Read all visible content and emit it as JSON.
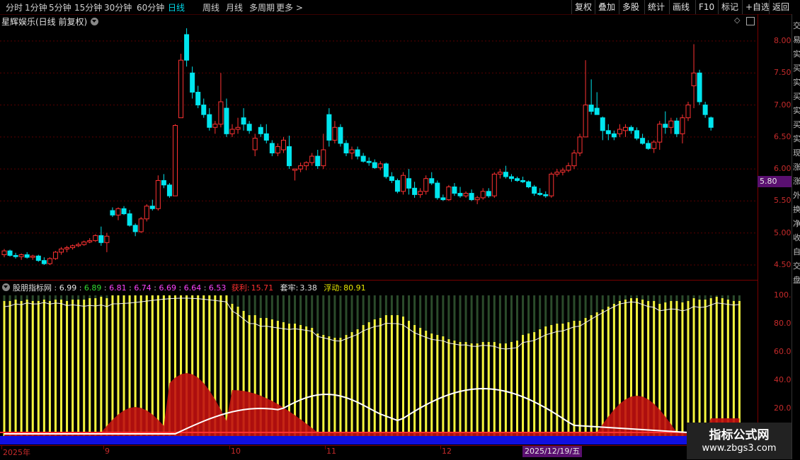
{
  "toolbar": {
    "periods": [
      "分时",
      "1分钟",
      "5分钟",
      "15分钟",
      "30分钟",
      "60分钟",
      "日线",
      "周线",
      "月线",
      "多周期",
      "更多 >"
    ],
    "active": "日线",
    "right_buttons": [
      "复权",
      "叠加",
      "多股",
      "统计",
      "画线",
      "F10",
      "标记",
      "+自选",
      "返回"
    ]
  },
  "chart": {
    "title": "星辉娱乐(日线 前复权)",
    "price_axis": [
      "8.00",
      "7.50",
      "7.00",
      "6.50",
      "6.00",
      "5.50",
      "5.00",
      "4.50"
    ],
    "current_price": "5.80",
    "colors": {
      "up": "#ff3232",
      "down": "#00e5ee",
      "grid": "#7a0000",
      "axis_text": "#c62b2b"
    }
  },
  "indicator": {
    "name": "股朋指标网",
    "values": [
      {
        "text": "6.99",
        "color": "#e8e8e8"
      },
      {
        "text": "6.89",
        "color": "#33dd33"
      },
      {
        "text": "6.81",
        "color": "#ff44ff"
      },
      {
        "text": "6.74",
        "color": "#ff44ff"
      },
      {
        "text": "6.69",
        "color": "#ff44ff"
      },
      {
        "text": "6.64",
        "color": "#ff44ff"
      },
      {
        "text": "6.53",
        "color": "#ff44ff"
      }
    ],
    "profit_label": "获利:",
    "profit_value": "15.71",
    "trapped_label": "套牢:",
    "trapped_value": "3.38",
    "float_label": "浮动:",
    "float_value": "80.91",
    "axis": [
      "100.0",
      "80.00",
      "60.00",
      "40.00",
      "20.00"
    ]
  },
  "date_axis": {
    "labels": [
      "2025年",
      "9",
      "10",
      "11",
      "12"
    ],
    "cursor_date": "2025/12/19/五"
  },
  "side_text": [
    "交",
    "易",
    "实",
    "买",
    "实",
    "买",
    "实",
    "买",
    "实",
    "现",
    "涨",
    "涨",
    "外",
    "换",
    "净",
    "收",
    "自",
    "交",
    "盘"
  ],
  "watermark": {
    "title": "指标公式网",
    "url": "www.zbgs3.com"
  },
  "candles": [
    [
      4.66,
      4.75,
      4.62,
      4.72
    ],
    [
      4.72,
      4.74,
      4.63,
      4.65
    ],
    [
      4.65,
      4.69,
      4.6,
      4.63
    ],
    [
      4.63,
      4.68,
      4.58,
      4.66
    ],
    [
      4.66,
      4.7,
      4.6,
      4.62
    ],
    [
      4.62,
      4.66,
      4.58,
      4.64
    ],
    [
      4.64,
      4.66,
      4.55,
      4.57
    ],
    [
      4.57,
      4.62,
      4.5,
      4.52
    ],
    [
      4.52,
      4.62,
      4.5,
      4.6
    ],
    [
      4.6,
      4.72,
      4.58,
      4.7
    ],
    [
      4.7,
      4.78,
      4.66,
      4.75
    ],
    [
      4.75,
      4.8,
      4.7,
      4.77
    ],
    [
      4.77,
      4.82,
      4.74,
      4.8
    ],
    [
      4.8,
      4.85,
      4.78,
      4.82
    ],
    [
      4.82,
      4.88,
      4.8,
      4.86
    ],
    [
      4.86,
      4.92,
      4.84,
      4.88
    ],
    [
      4.88,
      4.98,
      4.86,
      4.96
    ],
    [
      4.96,
      5.1,
      4.8,
      4.85
    ],
    [
      4.85,
      5.0,
      4.7,
      4.95
    ],
    [
      5.35,
      5.4,
      5.25,
      5.28
    ],
    [
      5.28,
      5.4,
      5.2,
      5.38
    ],
    [
      5.38,
      5.42,
      5.28,
      5.3
    ],
    [
      5.3,
      5.36,
      5.1,
      5.12
    ],
    [
      5.12,
      5.15,
      4.95,
      5.02
    ],
    [
      5.02,
      5.25,
      5.0,
      5.22
    ],
    [
      5.22,
      5.45,
      5.18,
      5.42
    ],
    [
      5.42,
      5.52,
      5.35,
      5.38
    ],
    [
      5.38,
      5.9,
      5.35,
      5.82
    ],
    [
      5.82,
      5.92,
      5.7,
      5.75
    ],
    [
      5.75,
      5.78,
      5.55,
      5.58
    ],
    [
      5.58,
      6.7,
      5.58,
      6.68
    ],
    [
      6.8,
      7.8,
      6.8,
      7.7
    ],
    [
      8.1,
      8.2,
      7.6,
      7.7
    ],
    [
      7.5,
      7.6,
      7.1,
      7.2
    ],
    [
      7.2,
      7.3,
      6.95,
      7.0
    ],
    [
      7.0,
      7.1,
      6.8,
      6.85
    ],
    [
      6.85,
      6.95,
      6.6,
      6.65
    ],
    [
      6.65,
      6.75,
      6.55,
      6.7
    ],
    [
      6.7,
      7.5,
      6.65,
      7.05
    ],
    [
      6.95,
      7.1,
      6.5,
      6.55
    ],
    [
      6.55,
      6.7,
      6.5,
      6.62
    ],
    [
      6.62,
      6.8,
      6.55,
      6.65
    ],
    [
      6.8,
      6.95,
      6.6,
      6.7
    ],
    [
      6.7,
      6.75,
      6.55,
      6.6
    ],
    [
      6.3,
      6.55,
      6.2,
      6.48
    ],
    [
      6.65,
      6.7,
      6.5,
      6.55
    ],
    [
      6.55,
      6.7,
      6.4,
      6.45
    ],
    [
      6.4,
      6.45,
      6.2,
      6.25
    ],
    [
      6.25,
      6.4,
      6.2,
      6.35
    ],
    [
      6.3,
      6.5,
      6.25,
      6.45
    ],
    [
      6.35,
      6.52,
      6.0,
      6.05
    ],
    [
      5.98,
      6.0,
      5.82,
      6.0
    ],
    [
      6.0,
      6.1,
      5.95,
      6.05
    ],
    [
      6.05,
      6.12,
      5.98,
      6.1
    ],
    [
      6.1,
      6.25,
      6.05,
      6.2
    ],
    [
      6.2,
      6.3,
      6.0,
      6.05
    ],
    [
      6.05,
      6.55,
      6.0,
      6.3
    ],
    [
      6.85,
      6.95,
      6.35,
      6.45
    ],
    [
      6.45,
      6.75,
      6.4,
      6.65
    ],
    [
      6.65,
      6.7,
      6.35,
      6.4
    ],
    [
      6.4,
      6.45,
      6.2,
      6.25
    ],
    [
      6.25,
      6.35,
      6.15,
      6.3
    ],
    [
      6.3,
      6.35,
      6.15,
      6.2
    ],
    [
      6.2,
      6.25,
      6.1,
      6.12
    ],
    [
      6.12,
      6.18,
      6.05,
      6.1
    ],
    [
      6.1,
      6.15,
      6.0,
      6.02
    ],
    [
      6.02,
      6.12,
      5.98,
      6.08
    ],
    [
      6.08,
      6.1,
      5.85,
      5.88
    ],
    [
      5.88,
      5.95,
      5.78,
      5.82
    ],
    [
      5.82,
      5.85,
      5.62,
      5.65
    ],
    [
      5.65,
      5.95,
      5.6,
      5.9
    ],
    [
      5.85,
      6.0,
      5.6,
      5.7
    ],
    [
      5.7,
      5.8,
      5.55,
      5.6
    ],
    [
      5.6,
      5.7,
      5.55,
      5.65
    ],
    [
      5.65,
      5.9,
      5.6,
      5.85
    ],
    [
      5.85,
      5.95,
      5.75,
      5.78
    ],
    [
      5.78,
      5.82,
      5.52,
      5.55
    ],
    [
      5.55,
      5.6,
      5.5,
      5.52
    ],
    [
      5.52,
      5.75,
      5.5,
      5.72
    ],
    [
      5.72,
      5.78,
      5.58,
      5.62
    ],
    [
      5.62,
      5.72,
      5.55,
      5.58
    ],
    [
      5.58,
      5.65,
      5.55,
      5.62
    ],
    [
      5.62,
      5.68,
      5.5,
      5.52
    ],
    [
      5.52,
      5.58,
      5.45,
      5.55
    ],
    [
      5.55,
      5.7,
      5.52,
      5.65
    ],
    [
      5.65,
      5.7,
      5.55,
      5.58
    ],
    [
      5.58,
      5.95,
      5.55,
      5.92
    ],
    [
      5.92,
      6.0,
      5.85,
      5.95
    ],
    [
      5.95,
      6.05,
      5.85,
      5.88
    ],
    [
      5.88,
      5.92,
      5.8,
      5.85
    ],
    [
      5.85,
      5.88,
      5.8,
      5.82
    ],
    [
      5.82,
      5.88,
      5.78,
      5.8
    ],
    [
      5.8,
      5.82,
      5.7,
      5.72
    ],
    [
      5.72,
      5.75,
      5.58,
      5.62
    ],
    [
      5.62,
      5.7,
      5.58,
      5.6
    ],
    [
      5.6,
      5.65,
      5.55,
      5.58
    ],
    [
      5.58,
      5.95,
      5.55,
      5.92
    ],
    [
      5.92,
      6.0,
      5.88,
      5.95
    ],
    [
      5.95,
      6.02,
      5.9,
      5.98
    ],
    [
      5.98,
      6.1,
      5.95,
      6.05
    ],
    [
      6.05,
      6.3,
      6.0,
      6.25
    ],
    [
      6.25,
      6.55,
      6.2,
      6.5
    ],
    [
      6.5,
      7.7,
      6.5,
      7.0
    ],
    [
      7.0,
      7.4,
      6.85,
      6.9
    ],
    [
      6.95,
      7.2,
      6.85,
      6.85
    ],
    [
      6.8,
      6.82,
      6.45,
      6.6
    ],
    [
      6.6,
      6.7,
      6.45,
      6.55
    ],
    [
      6.55,
      6.6,
      6.45,
      6.5
    ],
    [
      6.55,
      6.7,
      6.5,
      6.62
    ],
    [
      6.6,
      6.7,
      6.5,
      6.65
    ],
    [
      6.65,
      6.68,
      6.55,
      6.6
    ],
    [
      6.6,
      6.65,
      6.45,
      6.48
    ],
    [
      6.48,
      6.55,
      6.38,
      6.4
    ],
    [
      6.4,
      6.45,
      6.3,
      6.32
    ],
    [
      6.32,
      6.45,
      6.25,
      6.42
    ],
    [
      6.42,
      6.75,
      6.3,
      6.7
    ],
    [
      6.7,
      6.9,
      6.55,
      6.65
    ],
    [
      6.65,
      6.8,
      6.55,
      6.75
    ],
    [
      6.75,
      6.8,
      6.5,
      6.55
    ],
    [
      6.55,
      6.85,
      6.4,
      6.8
    ],
    [
      6.8,
      7.05,
      6.75,
      7.0
    ],
    [
      7.3,
      7.95,
      6.95,
      7.5
    ],
    [
      7.5,
      7.55,
      7.0,
      7.05
    ],
    [
      7.0,
      7.05,
      6.8,
      6.85
    ],
    [
      6.8,
      6.82,
      6.6,
      6.65
    ]
  ],
  "indicator_series": {
    "yellow_bars": [
      96,
      96,
      97,
      96,
      97,
      96,
      96,
      97,
      96,
      97,
      97,
      96,
      97,
      97,
      97,
      98,
      98,
      99,
      98,
      100,
      100,
      100,
      100,
      100,
      100,
      100,
      100,
      100,
      100,
      100,
      100,
      100,
      100,
      100,
      100,
      100,
      100,
      100,
      100,
      100,
      94,
      92,
      89,
      86,
      86,
      84,
      84,
      83,
      82,
      81,
      80,
      80,
      79,
      78,
      77,
      73,
      72,
      71,
      70,
      70,
      72,
      74,
      76,
      79,
      81,
      83,
      84,
      86,
      86,
      86,
      85,
      82,
      79,
      77,
      75,
      73,
      72,
      71,
      69,
      68,
      67,
      67,
      66,
      66,
      67,
      67,
      67,
      66,
      66,
      67,
      68,
      72,
      73,
      74,
      76,
      78,
      79,
      80,
      80,
      81,
      82,
      82,
      84,
      86,
      88,
      90,
      92,
      94,
      96,
      97,
      98,
      98,
      97,
      96,
      96,
      94,
      95,
      96,
      96,
      95,
      96,
      98,
      97,
      97,
      98,
      99,
      98,
      97,
      96,
      96
    ]
  }
}
